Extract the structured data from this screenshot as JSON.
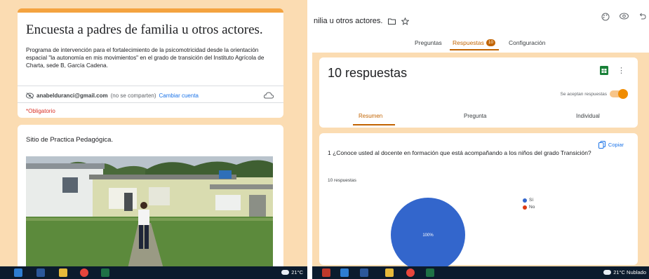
{
  "left_form": {
    "title": "Encuesta a padres de familia u otros actores.",
    "description": "Programa de intervención para el fortalecimiento de la psicomotricidad desde la orientación espacial \"la autonomía en mis movimientos\" en el grado de transición del Instituto Agrícola de Charta, sede B, García Cadena.",
    "account_email": "anabelduranci@gmail.com",
    "account_note": "(no se comparten)",
    "switch_account": "Cambiar cuenta",
    "required_note": "*Obligatorio",
    "section_title": "Sitio de Practica Pedagógica."
  },
  "right_form": {
    "doc_title": "nilia u otros actores.",
    "tabs": {
      "questions": "Preguntas",
      "responses": "Respuestas",
      "responses_badge": "10",
      "settings": "Configuración"
    },
    "summary": {
      "count_label": "10 respuestas",
      "accepting_label": "Se aceptan respuestas",
      "accepting": true,
      "subtabs": {
        "summary": "Resumen",
        "question": "Pregunta",
        "individual": "Individual"
      }
    },
    "question_card": {
      "copy_label": "Copiar",
      "question": "1 ¿Conoce usted al docente en formación que está acompañando a los niños del grado Transición?",
      "response_count": "10 respuestas"
    }
  },
  "chart_data": {
    "type": "pie",
    "categories": [
      "Sí",
      "No"
    ],
    "values": [
      100,
      0
    ],
    "slice_label": "100%",
    "colors": [
      "#3366cc",
      "#dc3912"
    ]
  },
  "taskbar": {
    "left_weather": "21°C",
    "right_weather": "21°C Nublado"
  },
  "colors": {
    "accent": "#f4a340",
    "active_tab": "#c26401",
    "background": "#fbdcb2",
    "link": "#1a73e8"
  },
  "icons": {
    "folder": "folder-icon",
    "star": "star-icon",
    "palette": "palette-icon",
    "preview": "eye-icon",
    "undo": "undo-icon",
    "sheets": "sheets-icon",
    "copy": "copy-icon",
    "cloud": "cloud-icon"
  }
}
